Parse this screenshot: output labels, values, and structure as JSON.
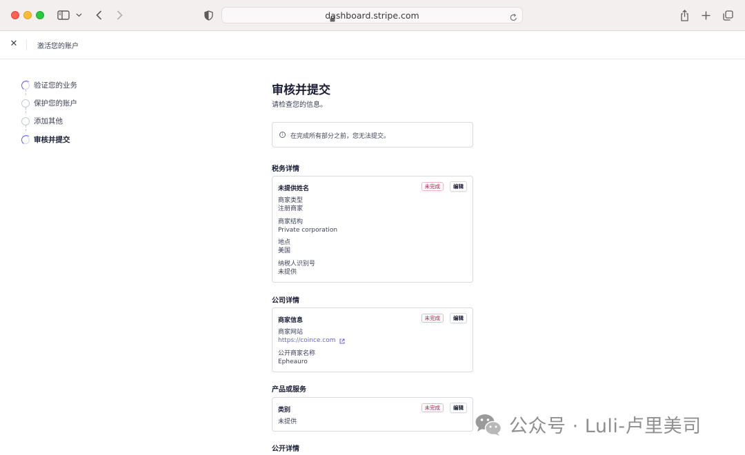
{
  "browser": {
    "url": "dashboard.stripe.com"
  },
  "topbar": {
    "title": "激活您的账户"
  },
  "steps": [
    {
      "label": "验证您的业务",
      "state": "in-progress"
    },
    {
      "label": "保护您的账户",
      "state": "pending"
    },
    {
      "label": "添加其他",
      "state": "pending"
    },
    {
      "label": "审核并提交",
      "state": "in-progress",
      "active": true
    }
  ],
  "main": {
    "title": "审核并提交",
    "subtitle": "请检查您的信息。",
    "notice": "在完成所有部分之前，您无法提交。"
  },
  "sections": {
    "tax": {
      "title": "税务详情",
      "card_title": "未提供姓名",
      "badge": "未完成",
      "edit": "编辑",
      "fields": [
        {
          "label": "商家类型",
          "value": "注册商家"
        },
        {
          "label": "商家结构",
          "value": "Private corporation"
        },
        {
          "label": "地点",
          "value": "美国"
        },
        {
          "label": "纳税人识别号",
          "value": "未提供"
        }
      ]
    },
    "company": {
      "title": "公司详情",
      "card_title": "商家信息",
      "badge": "未完成",
      "edit": "编辑",
      "fields": [
        {
          "label": "商家网站",
          "value": "https://coince.com"
        },
        {
          "label": "公开商家名称",
          "value": "Epheauro"
        }
      ]
    },
    "products": {
      "title": "产品或服务",
      "card_title": "类别",
      "badge": "未完成",
      "edit": "编辑",
      "value": "未提供"
    },
    "public": {
      "title": "公开详情"
    }
  },
  "watermark": {
    "text": "公众号 · Luli-卢里美司"
  },
  "colors": {
    "accent": "#635bff",
    "badge_text": "#c0123c",
    "badge_border": "#f3b5bd"
  }
}
